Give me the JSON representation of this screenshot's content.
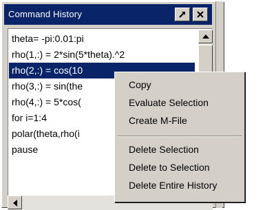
{
  "window": {
    "title": "Command History"
  },
  "history": {
    "rows": [
      "theta= -pi:0.01:pi",
      "rho(1,:) = 2*sin(5*theta).^2",
      "rho(2,:) = cos(10",
      "rho(3,:) = sin(the",
      "rho(4,:) = 5*cos(",
      "for i=1:4",
      "polar(theta,rho(i",
      "pause"
    ],
    "selected_index": 2
  },
  "context_menu": {
    "items": [
      "Copy",
      "Evaluate Selection",
      "Create M-File",
      "Delete Selection",
      "Delete to Selection",
      "Delete Entire History"
    ]
  },
  "colors": {
    "titlebar": "#0a246a",
    "selection": "#0a246a",
    "face": "#d4d0c8"
  },
  "icons": {
    "undock": "undock-arrow-icon",
    "close": "close-icon",
    "scroll_up": "triangle-up-icon",
    "scroll_left": "triangle-left-icon"
  }
}
